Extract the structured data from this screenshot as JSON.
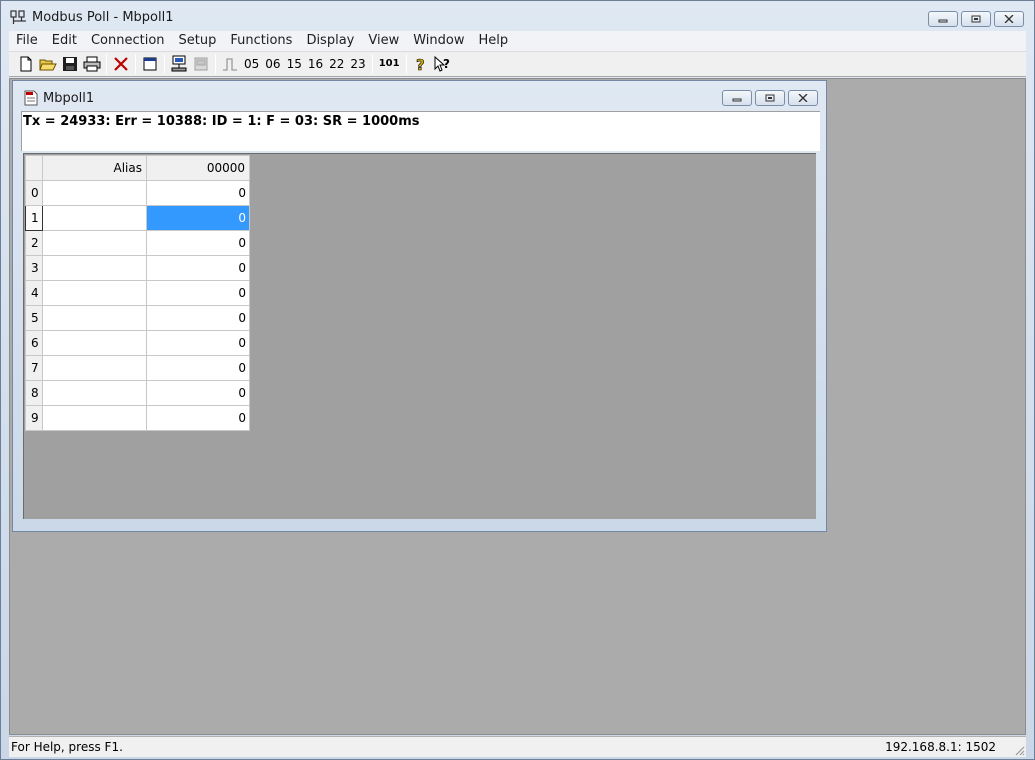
{
  "window": {
    "title": "Modbus Poll - Mbpoll1",
    "icon": "modbus-app-icon"
  },
  "menu": [
    "File",
    "Edit",
    "Connection",
    "Setup",
    "Functions",
    "Display",
    "View",
    "Window",
    "Help"
  ],
  "toolbar": {
    "icons": [
      "new-icon",
      "open-icon",
      "save-icon",
      "print-icon",
      "delete-icon",
      "window-icon",
      "connect-icon",
      "disconnect-icon",
      "pulse-icon",
      "help-icon",
      "context-help-icon"
    ],
    "function_codes": [
      "05",
      "06",
      "15",
      "16",
      "22",
      "23"
    ],
    "label_101": "101"
  },
  "child": {
    "title": "Mbpoll1",
    "status": "Tx = 24933: Err = 10388: ID = 1: F = 03: SR = 1000ms",
    "grid": {
      "col_alias": "Alias",
      "col_value": "00000",
      "rows": [
        {
          "index": "0",
          "alias": "",
          "value": "0"
        },
        {
          "index": "1",
          "alias": "",
          "value": "0"
        },
        {
          "index": "2",
          "alias": "",
          "value": "0"
        },
        {
          "index": "3",
          "alias": "",
          "value": "0"
        },
        {
          "index": "4",
          "alias": "",
          "value": "0"
        },
        {
          "index": "5",
          "alias": "",
          "value": "0"
        },
        {
          "index": "6",
          "alias": "",
          "value": "0"
        },
        {
          "index": "7",
          "alias": "",
          "value": "0"
        },
        {
          "index": "8",
          "alias": "",
          "value": "0"
        },
        {
          "index": "9",
          "alias": "",
          "value": "0"
        }
      ],
      "selected_row": "1"
    }
  },
  "statusbar": {
    "help": "For Help, press F1.",
    "connection": "192.168.8.1: 1502"
  },
  "colors": {
    "selection": "#3399ff",
    "mdi_background": "#ababab"
  }
}
